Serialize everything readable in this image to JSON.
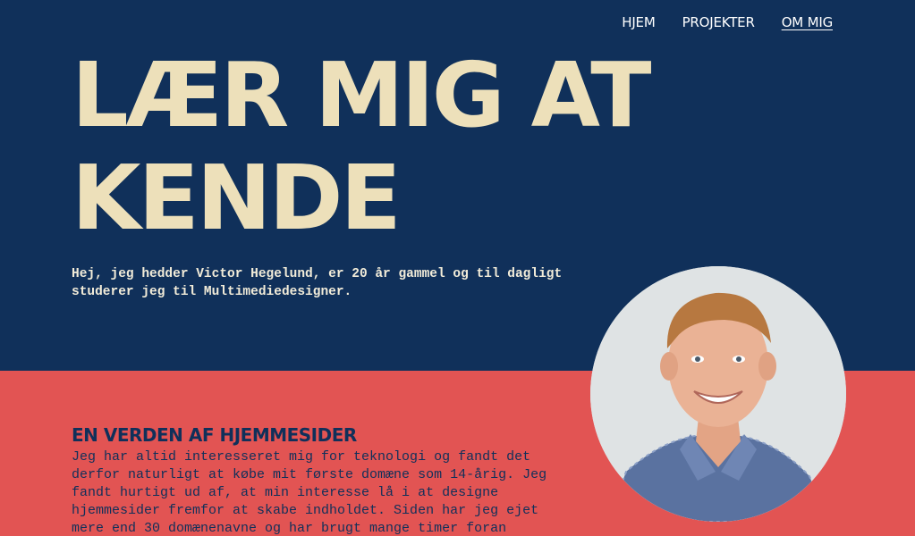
{
  "nav": {
    "items": [
      {
        "label": "HJEM",
        "active": false
      },
      {
        "label": "PROJEKTER",
        "active": false
      },
      {
        "label": "OM MIG",
        "active": true
      }
    ]
  },
  "hero": {
    "title_line1": "LÆR MIG AT",
    "title_line2": "KENDE",
    "intro": "Hej, jeg hedder Victor Hegelund, er 20 år gammel og til dagligt studerer jeg til Multimediedesigner."
  },
  "section": {
    "title": "EN VERDEN AF HJEMMESIDER",
    "body": "Jeg har altid interesseret mig for teknologi og fandt det derfor naturligt at købe mit første domæne som 14-årig. Jeg fandt hurtigt ud af, at min interesse lå i at designe hjemmesider fremfor at skabe indholdet. Siden har jeg ejet mere end 30 domænenavne og har brugt mange timer foran"
  },
  "portrait": {
    "icon": "portrait-photo"
  },
  "colors": {
    "navy": "#10305a",
    "coral": "#e25453",
    "cream": "#ede0ba"
  }
}
